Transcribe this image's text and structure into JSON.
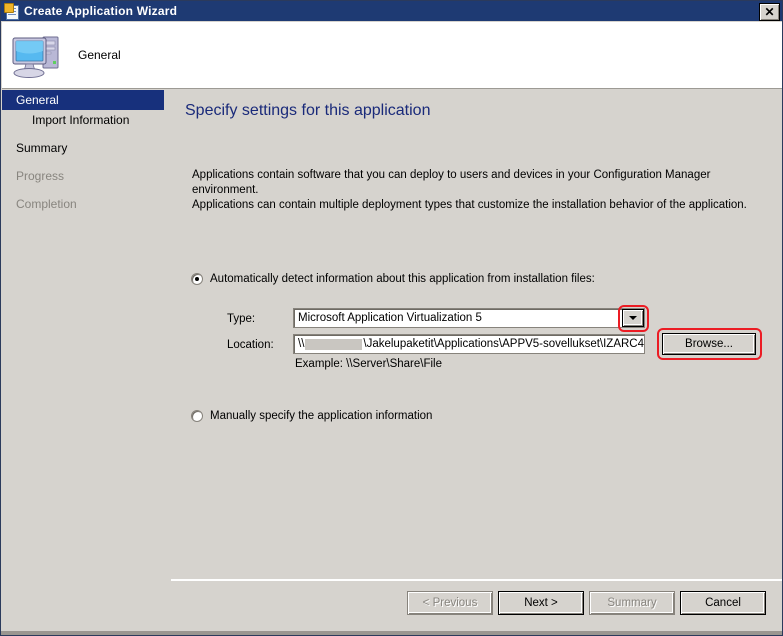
{
  "window": {
    "title": "Create Application Wizard",
    "title_icon": "wizard-document-icon",
    "close_label": "✕"
  },
  "header": {
    "icon": "computer-icon",
    "title": "General"
  },
  "sidebar": {
    "items": [
      {
        "label": "General",
        "state": "selected"
      },
      {
        "label": "Import Information",
        "state": "sub"
      },
      {
        "label": "Summary",
        "state": "normal"
      },
      {
        "label": "Progress",
        "state": "disabled"
      },
      {
        "label": "Completion",
        "state": "disabled"
      }
    ]
  },
  "main": {
    "heading": "Specify settings for this application",
    "intro_line1": "Applications contain software that you can deploy to users and devices in your Configuration Manager environment.",
    "intro_line2": "Applications can contain multiple deployment types that customize the installation behavior of the application.",
    "options": {
      "auto": {
        "label": "Automatically detect information about this application from installation files:",
        "selected": true
      },
      "manual": {
        "label": "Manually specify the application information",
        "selected": false
      }
    },
    "fields": {
      "type_label": "Type:",
      "type_value": "Microsoft Application Virtualization 5",
      "type_dropdown_icon": "chevron-down-icon",
      "location_label": "Location:",
      "location_prefix": "\\\\",
      "location_redacted": true,
      "location_suffix": "\\Jakelupaketit\\Applications\\APPV5-sovellukset\\IZARC4",
      "example_text": "Example: \\\\Server\\Share\\File",
      "browse_label": "Browse..."
    }
  },
  "annotations": {
    "color": "#ec1c24",
    "targets": [
      "type-dropdown-arrow",
      "browse-button"
    ]
  },
  "footer": {
    "buttons": [
      {
        "label": "< Previous",
        "enabled": false
      },
      {
        "label": "Next >",
        "enabled": true
      },
      {
        "label": "Summary",
        "enabled": false
      },
      {
        "label": "Cancel",
        "enabled": true
      }
    ]
  }
}
